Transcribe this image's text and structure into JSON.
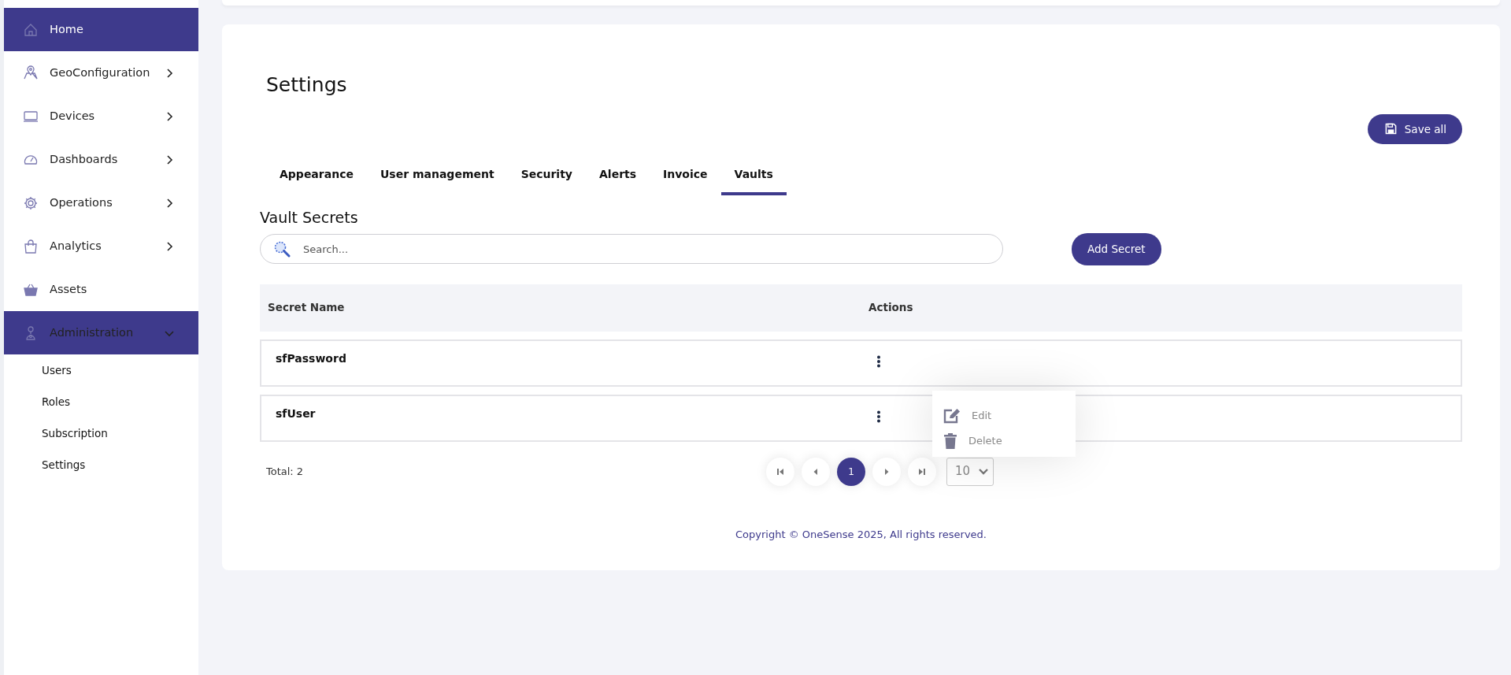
{
  "sidebar": {
    "items": [
      {
        "label": "Home",
        "kind": "link",
        "selected": true
      },
      {
        "label": "GeoConfiguration",
        "kind": "group",
        "selected": false,
        "expanded": false
      },
      {
        "label": "Devices",
        "kind": "group",
        "selected": false,
        "expanded": false
      },
      {
        "label": "Dashboards",
        "kind": "group",
        "selected": false,
        "expanded": false
      },
      {
        "label": "Operations",
        "kind": "group",
        "selected": false,
        "expanded": false
      },
      {
        "label": "Analytics",
        "kind": "group",
        "selected": false,
        "expanded": false
      },
      {
        "label": "Assets",
        "kind": "link",
        "selected": false
      },
      {
        "label": "Administration",
        "kind": "group",
        "selected": false,
        "expanded": true,
        "children": [
          {
            "label": "Users"
          },
          {
            "label": "Roles"
          },
          {
            "label": "Subscription"
          },
          {
            "label": "Settings"
          }
        ]
      }
    ]
  },
  "page": {
    "title": "Settings",
    "save_button": "Save all"
  },
  "tabs": [
    {
      "label": "Appearance",
      "selected": false
    },
    {
      "label": "User management",
      "selected": false
    },
    {
      "label": "Security",
      "selected": false
    },
    {
      "label": "Alerts",
      "selected": false
    },
    {
      "label": "Invoice",
      "selected": false
    },
    {
      "label": "Vaults",
      "selected": true
    }
  ],
  "section": {
    "title": "Vault Secrets",
    "search": {
      "placeholder": "Search..."
    },
    "add_button": "Add Secret"
  },
  "table": {
    "columns": [
      "Secret Name",
      "Actions"
    ],
    "rows": [
      {
        "secret_name": "sfPassword"
      },
      {
        "secret_name": "sfUser"
      }
    ]
  },
  "action_menu": {
    "items": [
      {
        "label": "Edit",
        "kind": "edit"
      },
      {
        "label": "Delete",
        "kind": "delete"
      }
    ]
  },
  "pagination": {
    "total": "Total: 2",
    "pages": [
      {
        "label": "1",
        "selected": true
      }
    ],
    "page_size": "10"
  },
  "footer": "Copyright © OneSense 2025, All rights reserved."
}
